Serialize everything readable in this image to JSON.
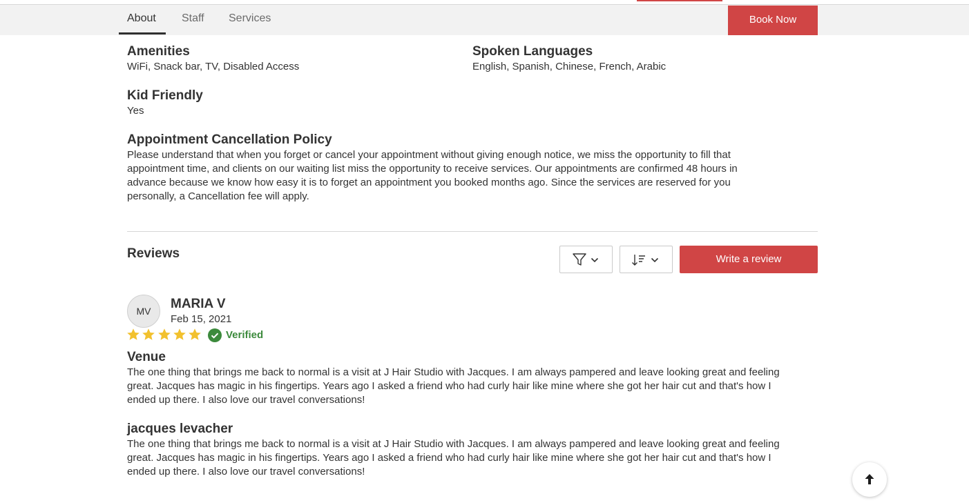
{
  "nav": {
    "tabs": [
      {
        "label": "About",
        "active": true
      },
      {
        "label": "Staff",
        "active": false
      },
      {
        "label": "Services",
        "active": false
      }
    ],
    "book_label": "Book Now"
  },
  "info": {
    "amenities": {
      "title": "Amenities",
      "value": "WiFi, Snack bar, TV, Disabled Access"
    },
    "languages": {
      "title": "Spoken Languages",
      "value": "English, Spanish, Chinese, French, Arabic"
    },
    "kid_friendly": {
      "title": "Kid Friendly",
      "value": "Yes"
    },
    "cancellation": {
      "title": "Appointment Cancellation Policy",
      "lines": [
        "Please understand that when you forget or cancel your appointment without giving enough notice, we miss the opportunity to fill that",
        "appointment time, and clients on our waiting list miss the opportunity to receive services. Our appointments are confirmed 48 hours in",
        "advance because we know how easy it is to forget an appointment you booked months ago. Since the services are reserved for you",
        "personally, a Cancellation fee will apply."
      ]
    }
  },
  "reviews": {
    "title": "Reviews",
    "filter_icon": "filter-icon",
    "sort_icon": "sort-icon",
    "write_label": "Write a review",
    "items": [
      {
        "initials": "MV",
        "name": "MARIA V",
        "date": "Feb 15, 2021",
        "rating": 5,
        "verified_label": "Verified",
        "sections": [
          {
            "title": "Venue",
            "lines": [
              "The one thing that brings me back to normal is a visit at J Hair Studio with Jacques. I am always pampered and leave looking great and feeling",
              "great. Jacques has magic in his fingertips. Years ago I asked a friend who had curly hair like mine where she got her hair cut and that's how I",
              "ended up there. I also love our travel conversations!"
            ]
          },
          {
            "title": "jacques levacher",
            "lines": [
              "The one thing that brings me back to normal is a visit at J Hair Studio with Jacques. I am always pampered and leave looking great and feeling",
              "great. Jacques has magic in his fingertips. Years ago I asked a friend who had curly hair like mine where she got her hair cut and that's how I",
              "ended up there. I also love our travel conversations!"
            ]
          }
        ]
      }
    ]
  },
  "colors": {
    "accent": "#d04545",
    "star": "#f2c12e",
    "verified": "#3c8a3c"
  },
  "scroll_top_icon": "arrow-up-icon"
}
